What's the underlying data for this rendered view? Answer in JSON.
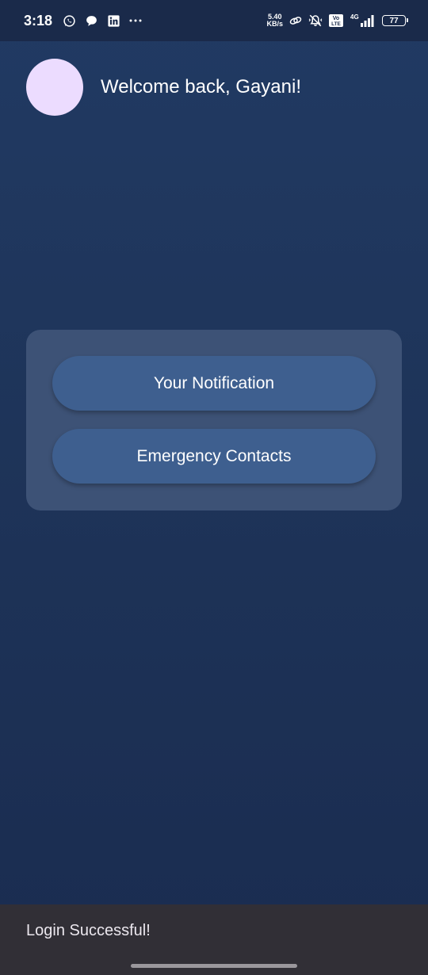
{
  "status_bar": {
    "time": "3:18",
    "left_icons": [
      "whatsapp-icon",
      "chat-bubble-icon",
      "linkedin-icon",
      "more-dots-icon"
    ],
    "net_speed_value": "5.40",
    "net_speed_unit": "KB/s",
    "right_icons": [
      "link-icon",
      "vibrate-off-icon",
      "volte-icon",
      "signal-4g-icon"
    ],
    "network_type": "4G",
    "volte_top": "Vo",
    "volte_bottom": "LTE",
    "battery_level": "77"
  },
  "header": {
    "welcome_text": "Welcome back, Gayani!"
  },
  "card": {
    "buttons": [
      {
        "label": "Your Notification"
      },
      {
        "label": "Emergency Contacts"
      }
    ]
  },
  "snackbar": {
    "message": "Login Successful!"
  },
  "colors": {
    "background_top": "#213a63",
    "background_bottom": "#1a2c50",
    "card": "#3d5276",
    "button": "#3e5f8f",
    "avatar": "#ecdcff",
    "snackbar": "#312f36"
  }
}
